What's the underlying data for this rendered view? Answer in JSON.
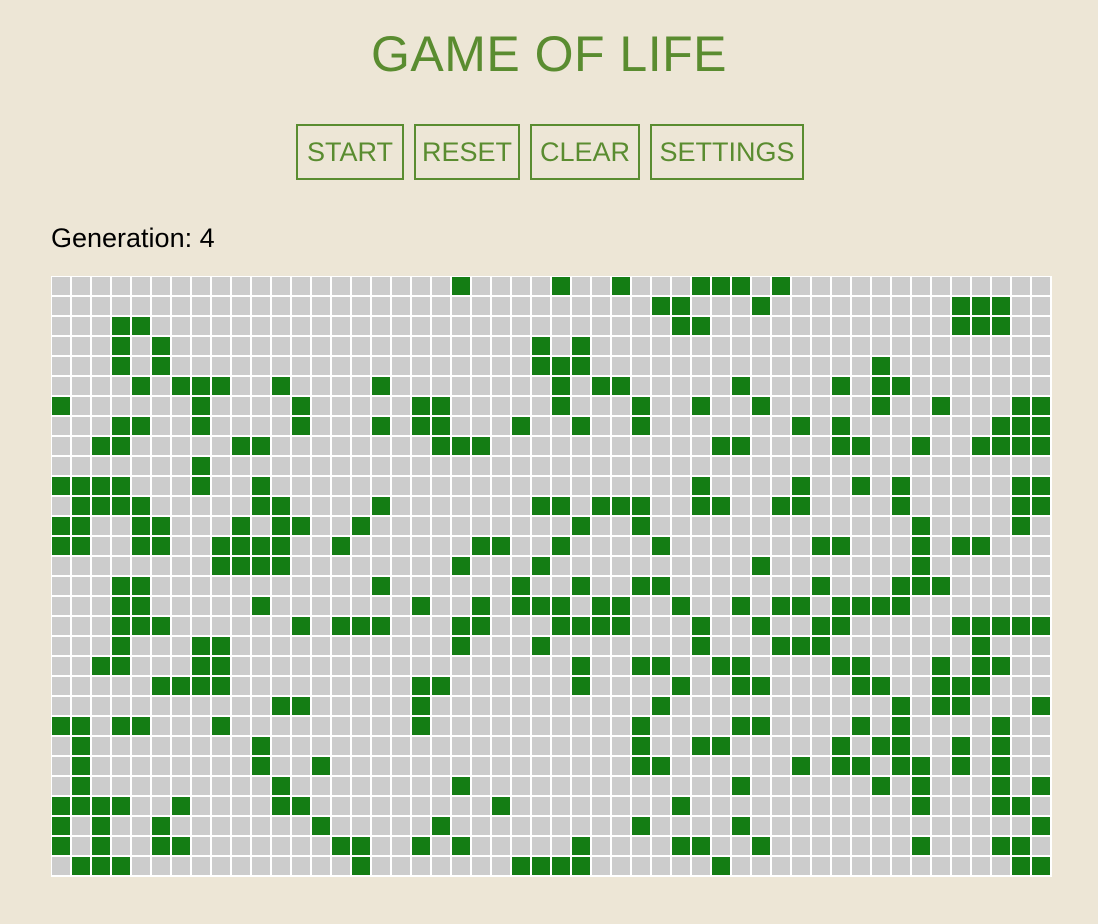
{
  "header": {
    "title": "GAME OF LIFE"
  },
  "toolbar": {
    "start_label": "START",
    "reset_label": "RESET",
    "clear_label": "CLEAR",
    "settings_label": "SETTINGS"
  },
  "status": {
    "generation_label": "Generation:",
    "generation_value": 4,
    "generation_text": "Generation: 4"
  },
  "colors": {
    "background": "#ede6d6",
    "accent": "#5a8c30",
    "dead_cell": "#cccccc",
    "live_cell": "#147d14",
    "grid_line": "#ffffff"
  },
  "board": {
    "columns": 50,
    "rows": 30,
    "alive_char": "#",
    "dead_char": ".",
    "grid": [
      "....................#....#..#...###.#.............",
      "..............................##...#.........###..",
      "...##..........................##............###..",
      "...#.#..................#.#.......................",
      "...#.#..................###..............#........",
      "....#.###..#....#........#.##.....#....#.##.......",
      "#......#....#.....##.....#...#..#..#.....#..#...##",
      "...##..#....#...#.##...#..#..#.......#.#.......###",
      "..##.....##........###...........##....##..#..####",
      ".......#..........................................",
      "####...#..#.....................#....#..#.#.....##",
      ".####.....##....#.......##.###..##..##....#.....##",
      "##..##...#.##..#..........#..#.............#....#.",
      "##..##..####..#......##..#....#.......##...#.##...",
      "........####........#...#..........#.......#......",
      "...##...........#......#..#..##.......#...###.....",
      "...##.....#.......#..#.###.##..#..#.##.####.......",
      "...###......#.###...##...####...#..#..##.....#####",
      "...#...##...........#...#.......#...###.......#...",
      "..##...##.................#..##..##....##...#.##..",
      ".....####.........##......#....#..##....##..###...",
      "...........##.....#...........#...........#.##...#",
      "##.##...#.........#..........#....##....#.#....#..",
      ".#........#..................#..##.....#.##..#.#..",
      ".#........#..#...............##......#.##.##.#.#..",
      ".#.........#........#.............#......#.#...#.#",
      "####..#....##.........#........#...........#...##.",
      "#.#..#.......#.....#.........#....#..............#",
      "#.#..##.......##..#.#.....#....##..#.......#...##.",
      ".###...........#.......####......#..............##"
    ]
  }
}
